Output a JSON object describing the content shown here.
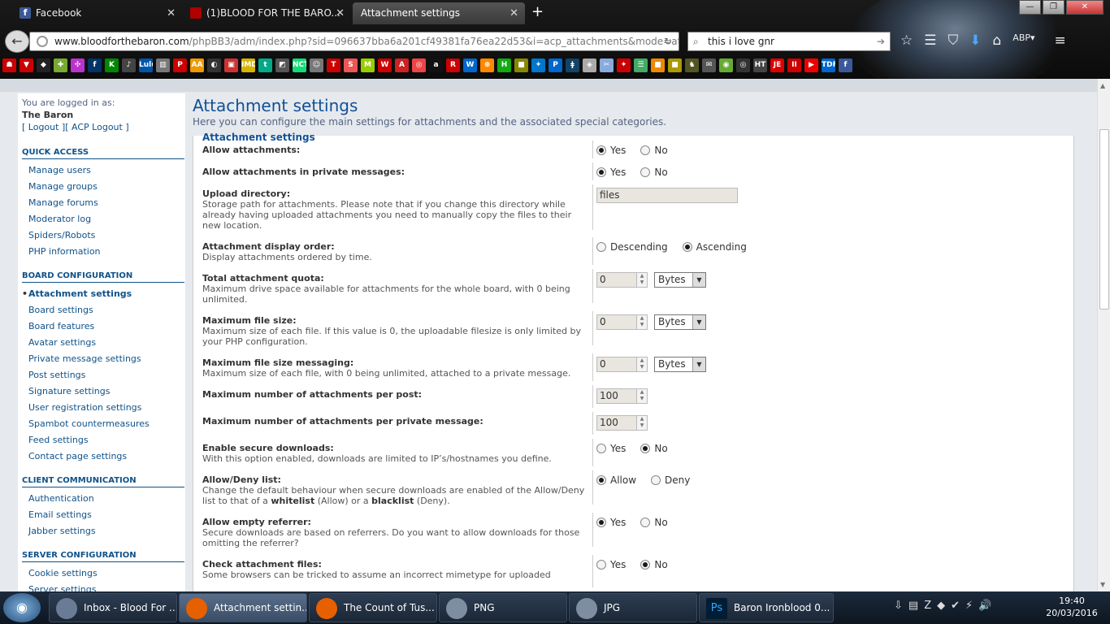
{
  "browser": {
    "tabs": [
      {
        "label": "Facebook",
        "color": "#3b5998"
      },
      {
        "label": "(1)BLOOD FOR THE BARO...",
        "color": "#b00000"
      },
      {
        "label": "Attachment settings",
        "color": "#444444"
      }
    ],
    "url_domain": "www.bloodforthebaron.com",
    "url_path": "/phpBB3/adm/index.php?sid=096637bba6a201cf49381fa76ea22d53&i=acp_attachments&mode=attach",
    "search_value": "this i love gnr",
    "bookmarks": [
      "☗",
      "▼",
      "◆",
      "✚",
      "✣",
      "f",
      "K",
      "♪",
      "Lulu",
      "▥",
      "P",
      "AA",
      "◐",
      "▣",
      "IMDb",
      "t",
      "◩",
      "NCT",
      "☺",
      "T",
      "S",
      "M",
      "W",
      "A",
      "◎",
      "a",
      "R",
      "W",
      "⊕",
      "H",
      "■",
      "✦",
      "P",
      "ǂ",
      "◈",
      "✂",
      "✦",
      "☰",
      "■",
      "■",
      "♞",
      "✉",
      "◉",
      "◎",
      "HT",
      "JE",
      "II",
      "▶",
      "TDF",
      "f"
    ],
    "bookmark_colors": [
      "#c00",
      "#c00",
      "#222",
      "#7a3",
      "#b3c",
      "#036",
      "#080",
      "#444",
      "#05a",
      "#777",
      "#c00",
      "#e90",
      "#333",
      "#c33",
      "#d8b400",
      "#0a8",
      "#555",
      "#1d7",
      "#777",
      "#c00",
      "#e55",
      "#9c0",
      "#c00",
      "#c22",
      "#e44",
      "#111",
      "#c00",
      "#06c",
      "#f80",
      "#1a1",
      "#880",
      "#07c",
      "#06c",
      "#146",
      "#aaa",
      "#8ad",
      "#c00",
      "#4a6",
      "#e80",
      "#a90",
      "#552",
      "#555",
      "#6a3",
      "#333",
      "#444",
      "#d00",
      "#c00",
      "#e00",
      "#06c",
      "#3b5998"
    ]
  },
  "menu": {
    "logged_in_as": "You are logged in as:",
    "username": "The Baron",
    "logout": "[ Logout ][ ACP Logout ]",
    "sections": [
      {
        "title": "QUICK ACCESS",
        "items": [
          "Manage users",
          "Manage groups",
          "Manage forums",
          "Moderator log",
          "Spiders/Robots",
          "PHP information"
        ]
      },
      {
        "title": "BOARD CONFIGURATION",
        "items": [
          "Attachment settings",
          "Board settings",
          "Board features",
          "Avatar settings",
          "Private message settings",
          "Post settings",
          "Signature settings",
          "User registration settings",
          "Spambot countermeasures",
          "Feed settings",
          "Contact page settings"
        ]
      },
      {
        "title": "CLIENT COMMUNICATION",
        "items": [
          "Authentication",
          "Email settings",
          "Jabber settings"
        ]
      },
      {
        "title": "SERVER CONFIGURATION",
        "items": [
          "Cookie settings",
          "Server settings"
        ]
      }
    ]
  },
  "main": {
    "title": "Attachment settings",
    "description": "Here you can configure the main settings for attachments and the associated special categories.",
    "panel_title": "Attachment settings",
    "settings": [
      {
        "title": "Allow attachments:",
        "desc": "",
        "type": "radio",
        "options": [
          "Yes",
          "No"
        ],
        "selected": 0
      },
      {
        "title": "Allow attachments in private messages:",
        "desc": "",
        "type": "radio",
        "options": [
          "Yes",
          "No"
        ],
        "selected": 0
      },
      {
        "title": "Upload directory:",
        "desc": "Storage path for attachments. Please note that if you change this directory while already having uploaded attachments you need to manually copy the files to their new location.",
        "type": "text",
        "value": "files"
      },
      {
        "title": "Attachment display order:",
        "desc": "Display attachments ordered by time.",
        "type": "radio",
        "options": [
          "Descending",
          "Ascending"
        ],
        "selected": 1
      },
      {
        "title": "Total attachment quota:",
        "desc": "Maximum drive space available for attachments for the whole board, with 0 being unlimited.",
        "type": "size",
        "value": "0",
        "unit": "Bytes"
      },
      {
        "title": "Maximum file size:",
        "desc": "Maximum size of each file. If this value is 0, the uploadable filesize is only limited by your PHP configuration.",
        "type": "size",
        "value": "0",
        "unit": "Bytes"
      },
      {
        "title": "Maximum file size messaging:",
        "desc": "Maximum size of each file, with 0 being unlimited, attached to a private message.",
        "type": "size",
        "value": "0",
        "unit": "Bytes"
      },
      {
        "title": "Maximum number of attachments per post:",
        "desc": "",
        "type": "number",
        "value": "100"
      },
      {
        "title": "Maximum number of attachments per private message:",
        "desc": "",
        "type": "number",
        "value": "100"
      },
      {
        "title": "Enable secure downloads:",
        "desc": "With this option enabled, downloads are limited to IP’s/hostnames you define.",
        "type": "radio",
        "options": [
          "Yes",
          "No"
        ],
        "selected": 1
      },
      {
        "title": "Allow/Deny list:",
        "desc": "Change the default behaviour when secure downloads are enabled of the Allow/Deny list to that of a |whitelist| (Allow) or a |blacklist| (Deny).",
        "type": "radio",
        "options": [
          "Allow",
          "Deny"
        ],
        "selected": 0
      },
      {
        "title": "Allow empty referrer:",
        "desc": "Secure downloads are based on referrers. Do you want to allow downloads for those omitting the referrer?",
        "type": "radio",
        "options": [
          "Yes",
          "No"
        ],
        "selected": 0
      },
      {
        "title": "Check attachment files:",
        "desc": "Some browsers can be tricked to assume an incorrect mimetype for uploaded",
        "type": "radio",
        "options": [
          "Yes",
          "No"
        ],
        "selected": 1
      }
    ]
  },
  "taskbar": {
    "tasks": [
      {
        "label": "Inbox - Blood For ...",
        "color": "#6a7c95"
      },
      {
        "label": "Attachment settin...",
        "color": "#e66000"
      },
      {
        "label": "The Count of Tus...",
        "color": "#e66000"
      },
      {
        "label": "PNG",
        "color": "#7f8da0"
      },
      {
        "label": "JPG",
        "color": "#7f8da0"
      },
      {
        "label": "Baron Ironblood 0...",
        "color": "#001d34"
      }
    ],
    "tray_icons": [
      "⇩",
      "▤",
      "Z",
      "◆",
      "✔",
      "⚡",
      "🔊"
    ],
    "time": "19:40",
    "date": "20/03/2016"
  }
}
